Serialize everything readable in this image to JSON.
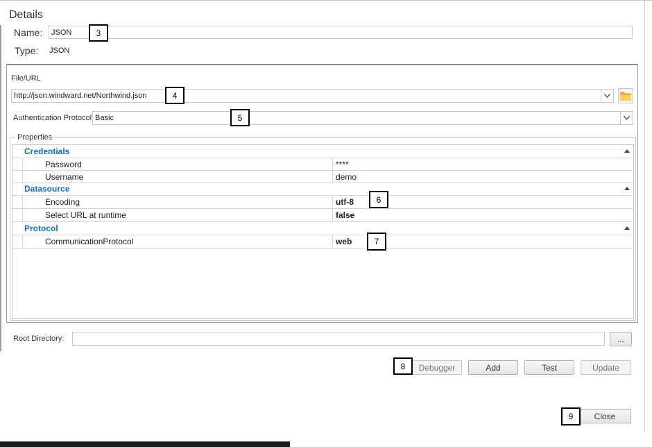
{
  "details": {
    "title": "Details",
    "name_label": "Name:",
    "name_value": "JSON",
    "type_label": "Type:",
    "type_value": "JSON"
  },
  "file_url": {
    "label": "File/URL",
    "value": "http://json.windward.net/Northwind.json"
  },
  "auth": {
    "label": "Authentication Protocol",
    "value": "Basic"
  },
  "properties": {
    "label": "Properties",
    "categories": [
      {
        "name": "Credentials",
        "rows": [
          {
            "name": "Password",
            "value": "****",
            "bold": false
          },
          {
            "name": "Username",
            "value": "demo",
            "bold": false
          }
        ]
      },
      {
        "name": "Datasource",
        "rows": [
          {
            "name": "Encoding",
            "value": "utf-8",
            "bold": true
          },
          {
            "name": "Select URL at runtime",
            "value": "false",
            "bold": true
          }
        ]
      },
      {
        "name": "Protocol",
        "rows": [
          {
            "name": "CommunicationProtocol",
            "value": "web",
            "bold": true
          }
        ]
      }
    ]
  },
  "root_directory": {
    "label": "Root Directory:",
    "value": "",
    "browse_label": "..."
  },
  "buttons": {
    "debugger": "Debugger",
    "add": "Add",
    "test": "Test",
    "update": "Update",
    "close": "Close"
  },
  "callouts": {
    "c3": "3",
    "c4": "4",
    "c5": "5",
    "c6": "6",
    "c7": "7",
    "c8": "8",
    "c9": "9"
  },
  "colors": {
    "category_text": "#1a6fb3",
    "folder_icon": "#f2b630",
    "taskbar": "#1c1c1c"
  }
}
